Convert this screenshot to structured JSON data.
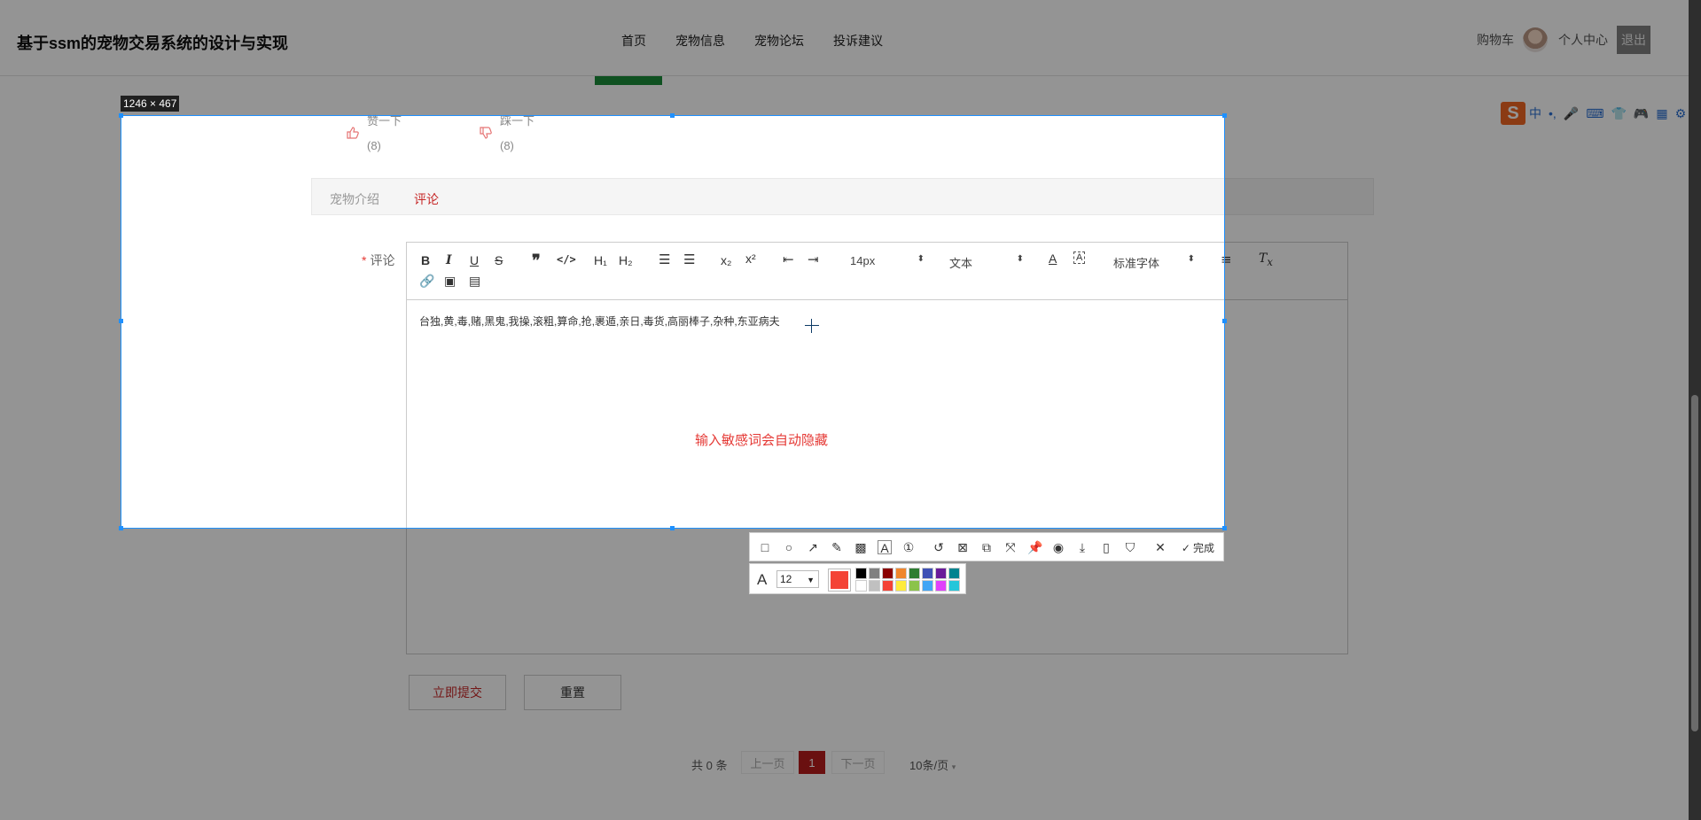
{
  "header": {
    "site_title": "基于ssm的宠物交易系统的设计与实现",
    "nav": [
      "首页",
      "宠物信息",
      "宠物论坛",
      "投诉建议"
    ],
    "cart": "购物车",
    "user_center": "个人中心",
    "logout": "退出"
  },
  "votes": {
    "like_label": "赞一下",
    "like_count": "(8)",
    "dislike_label": "踩一下",
    "dislike_count": "(8)"
  },
  "tabs": {
    "intro": "宠物介绍",
    "comment": "评论"
  },
  "form": {
    "label": "评论",
    "required_mark": "*",
    "editor": {
      "font_size": "14px",
      "text_type": "文本",
      "font_family": "标准字体",
      "content": "台独,黄,毒,赌,黑鬼,我操,滚粗,算命,抢,裹遁,亲日,毒货,高丽棒子,杂种,东亚病夫",
      "hint": "输入敏感词会自动隐藏"
    },
    "submit": "立即提交",
    "reset": "重置"
  },
  "pagination": {
    "total": "共 0 条",
    "prev": "上一页",
    "current": "1",
    "next": "下一页",
    "page_size": "10条/页"
  },
  "screenshot_tool": {
    "selection_size": "1246 × 467",
    "done": "完成",
    "font_size": "12",
    "current_color": "#f44336",
    "palette": [
      "#000000",
      "#808080",
      "#8b0000",
      "#f0862c",
      "#2e7d32",
      "#3f51b5",
      "#6a1b9a",
      "#00838f",
      "#ffffff",
      "#c0c0c0",
      "#f44336",
      "#ffeb3b",
      "#8bc34a",
      "#42a5f5",
      "#e040fb",
      "#26c6da"
    ]
  }
}
